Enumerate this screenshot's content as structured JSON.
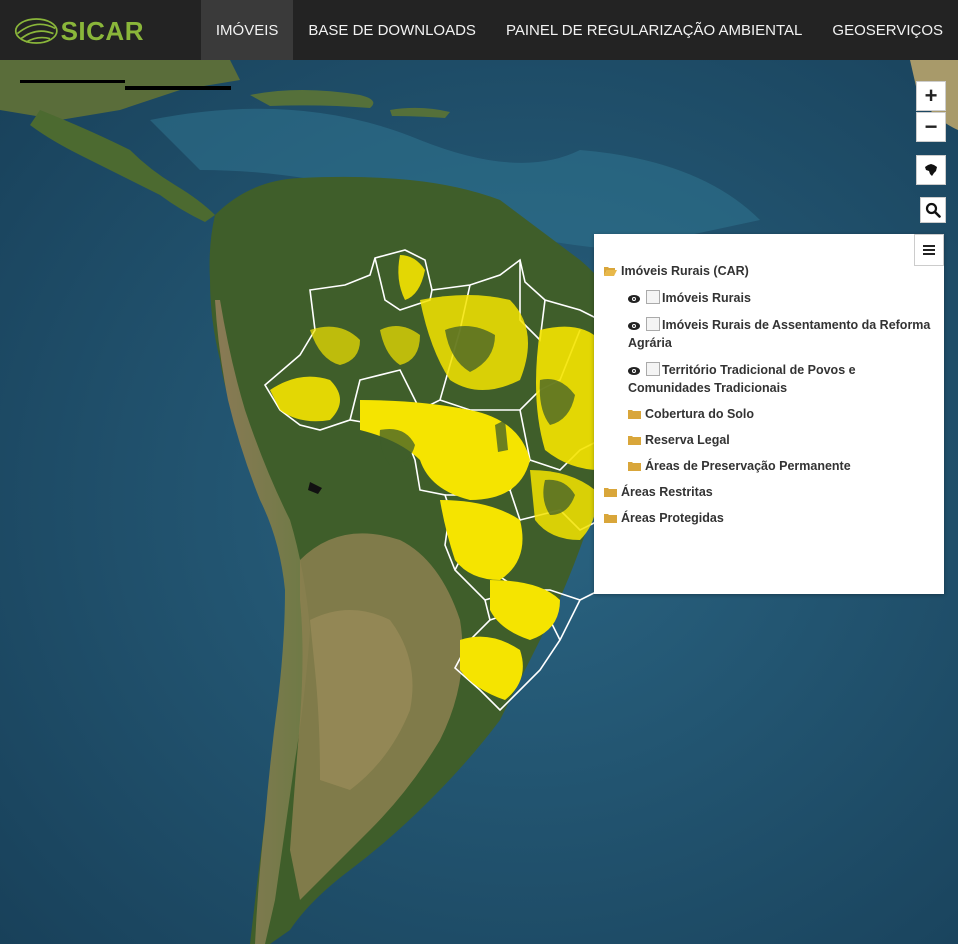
{
  "brand": {
    "name": "SICAR",
    "color": "#8ab63a"
  },
  "nav": {
    "items": [
      {
        "label": "IMÓVEIS",
        "active": true
      },
      {
        "label": "BASE DE DOWNLOADS",
        "active": false
      },
      {
        "label": "PAINEL DE REGULARIZAÇÃO AMBIENTAL",
        "active": false
      },
      {
        "label": "GEOSERVIÇOS",
        "active": false
      }
    ]
  },
  "map_controls": {
    "zoom_in": "+",
    "zoom_out": "−",
    "brazil_icon": "brazil-map-icon",
    "search_icon": "search-icon",
    "layers_icon": "menu-icon"
  },
  "layers": {
    "groups": [
      {
        "label": "Imóveis Rurais (CAR)",
        "expanded": true,
        "children": [
          {
            "label": "Imóveis Rurais",
            "visible": true
          },
          {
            "label": "Imóveis Rurais de Assentamento da Reforma Agrária",
            "visible": true
          },
          {
            "label": "Território Tradicional de Povos e Comunidades Tradicionais",
            "visible": true
          },
          {
            "label": "Cobertura do Solo",
            "folder": true
          },
          {
            "label": "Reserva Legal",
            "folder": true
          },
          {
            "label": "Áreas de Preservação Permanente",
            "folder": true
          }
        ]
      },
      {
        "label": "Áreas Restritas",
        "expanded": false
      },
      {
        "label": "Áreas Protegidas",
        "expanded": false
      }
    ]
  },
  "colors": {
    "ocean": "#1d4f6b",
    "land": "#4d6a32",
    "highlight": "#f5e400",
    "folder": "#d9a63a"
  }
}
